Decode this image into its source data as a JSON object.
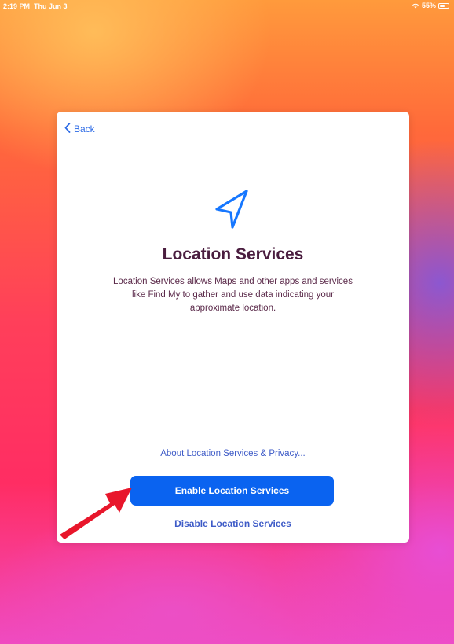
{
  "status_bar": {
    "time": "2:19 PM",
    "date": "Thu Jun 3",
    "battery": "55%",
    "battery_level": 0.55,
    "wifi_icon": "wifi-icon",
    "battery_icon": "battery-icon"
  },
  "sheet": {
    "back_label": "Back",
    "back_icon": "chevron-left-icon",
    "hero_icon": "location-arrow-icon",
    "title": "Location Services",
    "description": "Location Services allows Maps and other apps and services like Find My to gather and use data indicating your approximate location.",
    "about_link": "About Location Services & Privacy...",
    "enable_button": "Enable Location Services",
    "disable_link": "Disable Location Services"
  },
  "colors": {
    "accent": "#0a63f0",
    "link": "#3e5bc7",
    "title": "#4a1d3f",
    "annotation_arrow": "#e8162b"
  }
}
